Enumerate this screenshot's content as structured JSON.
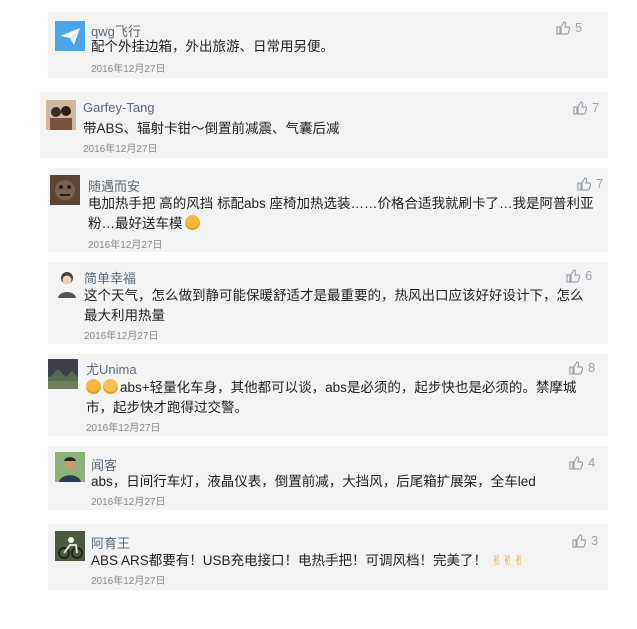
{
  "comments": [
    {
      "user": "qwg飞行",
      "likes": "5",
      "text": "配个外挂边箱，外出旅游、日常用另便。",
      "date": "2016年12月27日",
      "avatar": "paper-plane-avatar"
    },
    {
      "user": "Garfey-Tang",
      "likes": "7",
      "text": "带ABS、辐射卡钳～倒置前减震、气囊后减",
      "date": "2016年12月27日",
      "avatar": "couple-photo-avatar"
    },
    {
      "user": "随遇而安",
      "likes": "7",
      "text": "电加热手把 高的风挡 标配abs 座椅加热选装……价格合适我就刷卡了…我是阿普利亚粉…最好送车模",
      "date": "2016年12月27日",
      "avatar": "dark-pattern-avatar"
    },
    {
      "user": "简单幸福",
      "likes": "6",
      "text": "这个天气，怎么做到静可能保暖舒适才是最重要的，热风出口应该好好设计下，怎么最大利用热量",
      "date": "2016年12月27日",
      "avatar": "cartoon-person-avatar"
    },
    {
      "user": "尤Unima",
      "likes": "8",
      "text": "abs+轻量化车身，其他都可以谈，abs是必须的，起步快也是必须的。禁摩城市，起步快才跑得过交警。",
      "date": "2016年12月27日",
      "avatar": "landscape-avatar"
    },
    {
      "user": "闻客",
      "likes": "4",
      "text": "abs，日间行车灯，液晶仪表，倒置前减，大挡风，后尾箱扩展架，全车led",
      "date": "2016年12月27日",
      "avatar": "man-photo-avatar"
    },
    {
      "user": "阿育王",
      "likes": "3",
      "text": "ABS ARS都要有！USB充电接口！电热手把！可调风档！完美了！",
      "date": "2016年12月27日",
      "avatar": "rider-photo-avatar"
    }
  ]
}
